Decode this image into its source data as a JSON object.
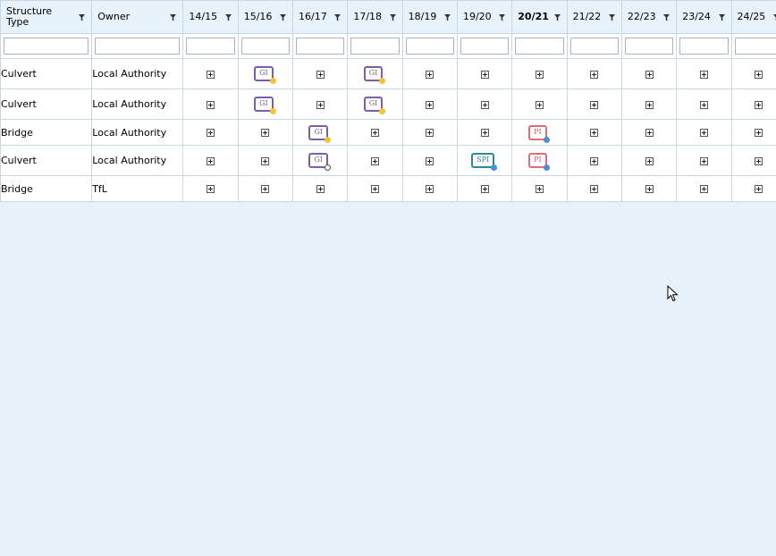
{
  "columns": [
    {
      "label": "Structure Type",
      "kind": "text"
    },
    {
      "label": "Owner",
      "kind": "text"
    },
    {
      "label": "14/15",
      "kind": "year"
    },
    {
      "label": "15/16",
      "kind": "year"
    },
    {
      "label": "16/17",
      "kind": "year"
    },
    {
      "label": "17/18",
      "kind": "year"
    },
    {
      "label": "18/19",
      "kind": "year"
    },
    {
      "label": "19/20",
      "kind": "year"
    },
    {
      "label": "20/21",
      "kind": "year",
      "current": true
    },
    {
      "label": "21/22",
      "kind": "year"
    },
    {
      "label": "22/23",
      "kind": "year"
    },
    {
      "label": "23/24",
      "kind": "year"
    },
    {
      "label": "24/25",
      "kind": "year"
    }
  ],
  "colors": {
    "gi_border": "#7b5ea7",
    "gi_text": "#6a5a8a",
    "pi_border": "#e06b72",
    "pi_text": "#c75a64",
    "spi_border": "#2a8c96",
    "spi_text": "#2a7c86",
    "dot_yellow": "#f5c232",
    "dot_blue": "#4a90d9",
    "dot_empty": "#ffffff"
  },
  "rows": [
    {
      "type": "Culvert",
      "owner": "Local Authority",
      "cells": [
        null,
        {
          "label": "GI",
          "style": "gi",
          "dot": "yellow"
        },
        null,
        {
          "label": "GI",
          "style": "gi",
          "dot": "yellow"
        },
        null,
        null,
        null,
        null,
        null,
        null,
        null
      ]
    },
    {
      "type": "Culvert",
      "owner": "Local Authority",
      "cells": [
        null,
        {
          "label": "GI",
          "style": "gi",
          "dot": "yellow"
        },
        null,
        {
          "label": "GI",
          "style": "gi",
          "dot": "yellow"
        },
        null,
        null,
        null,
        null,
        null,
        null,
        null
      ]
    },
    {
      "type": "Bridge",
      "owner": "Local Authority",
      "cells": [
        null,
        null,
        {
          "label": "GI",
          "style": "gi",
          "dot": "yellow"
        },
        null,
        null,
        null,
        {
          "label": "PI",
          "style": "pi",
          "dot": "blue"
        },
        null,
        null,
        null,
        null
      ]
    },
    {
      "type": "Culvert",
      "owner": "Local Authority",
      "cells": [
        null,
        null,
        {
          "label": "GI",
          "style": "gi",
          "dot": "empty"
        },
        null,
        null,
        {
          "label": "SPI",
          "style": "spi",
          "dot": "blue"
        },
        {
          "label": "PI",
          "style": "pi",
          "dot": "blue"
        },
        null,
        null,
        null,
        null
      ]
    },
    {
      "type": "Bridge",
      "owner": "TfL",
      "cells": [
        null,
        null,
        null,
        null,
        null,
        null,
        null,
        null,
        null,
        null,
        null
      ]
    }
  ]
}
